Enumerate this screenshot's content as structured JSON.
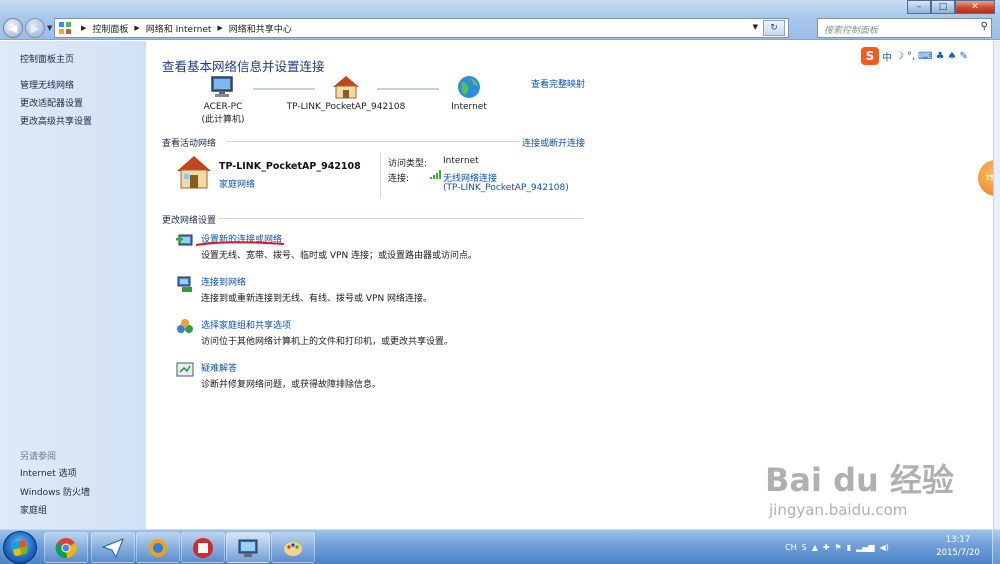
{
  "address_bar": {
    "crumbs": [
      "控制面板",
      "网络和 Internet",
      "网络和共享中心"
    ],
    "search_placeholder": "搜索控制面板"
  },
  "sidebar": {
    "items": [
      "控制面板主页",
      "管理无线网络",
      "更改适配器设置",
      "更改高级共享设置"
    ],
    "see_also_heading": "另请参阅",
    "see_also": [
      "Internet 选项",
      "Windows 防火墙",
      "家庭组"
    ]
  },
  "main": {
    "title": "查看基本网络信息并设置连接",
    "full_map_link": "查看完整映射",
    "map": {
      "computer_name": "ACER-PC",
      "computer_sub": "(此计算机)",
      "router_name": "TP-LINK_PocketAP_942108",
      "internet": "Internet"
    },
    "active_section": {
      "title": "查看活动网络",
      "link": "连接或断开连接",
      "network_name": "TP-LINK_PocketAP_942108",
      "network_type": "家庭网络",
      "access_type_label": "访问类型:",
      "access_type_value": "Internet",
      "connection_label": "连接:",
      "connection_value_line1": "无线网络连接",
      "connection_value_line2": "(TP-LINK_PocketAP_942108)"
    },
    "settings_section": {
      "title": "更改网络设置",
      "tasks": [
        {
          "link": "设置新的连接或网络",
          "desc": "设置无线、宽带、拨号、临时或 VPN 连接；或设置路由器或访问点。"
        },
        {
          "link": "连接到网络",
          "desc": "连接到或重新连接到无线、有线、拨号或 VPN 网络连接。"
        },
        {
          "link": "选择家庭组和共享选项",
          "desc": "访问位于其他网络计算机上的文件和打印机，或更改共享设置。"
        },
        {
          "link": "疑难解答",
          "desc": "诊断并修复网络问题，或获得故障排除信息。"
        }
      ]
    }
  },
  "ime_toolbar": {
    "logo": "S",
    "mode": "中",
    "badge": "75"
  },
  "taskbar": {
    "tray_lang": "CH",
    "time": "13:17",
    "date": "2015/7/20"
  },
  "watermark": {
    "brand": "Bai du 经验",
    "url": "jingyan.baidu.com"
  },
  "colors": {
    "link": "#0a51b3",
    "title": "#1e3e86",
    "sidebar_bg": "#d2e2f6",
    "annotation_red": "#d6191f"
  }
}
